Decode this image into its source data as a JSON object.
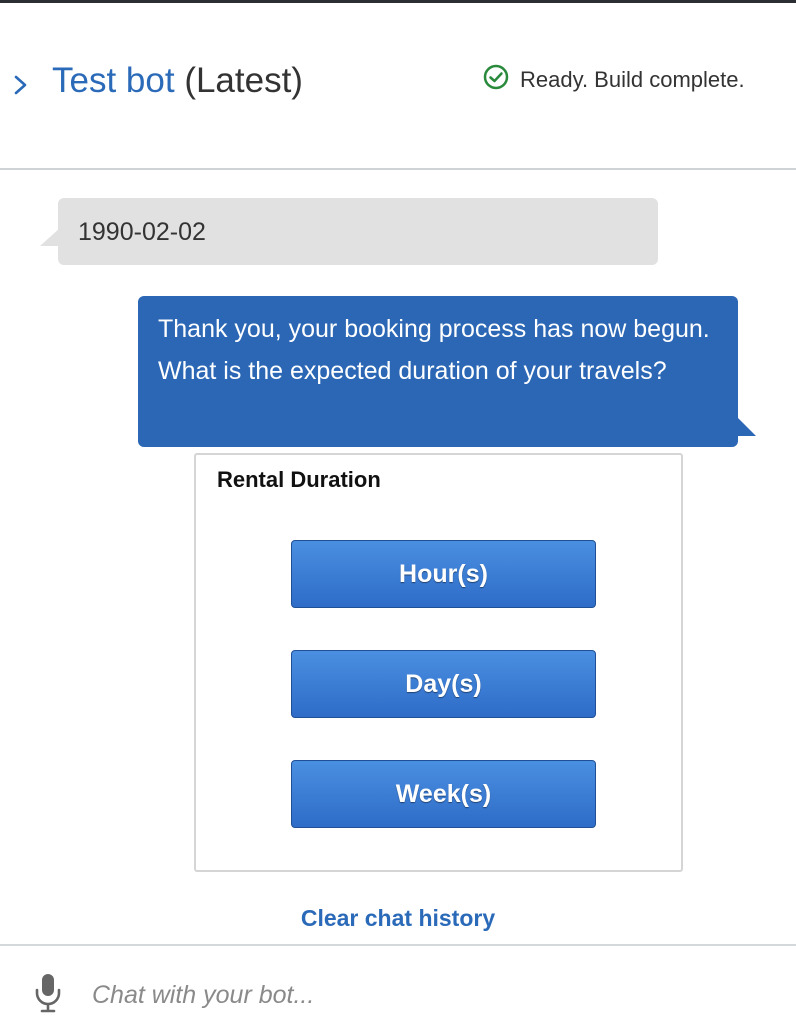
{
  "header": {
    "bot_name": "Test bot",
    "version": "(Latest)",
    "status": "Ready. Build complete.",
    "status_icon": "check-circle-icon",
    "status_color": "#2a8a3c"
  },
  "messages": {
    "user": "1990-02-02",
    "bot": "Thank you, your booking process has now begun. What is the expected duration of your travels?"
  },
  "card": {
    "title": "Rental Duration",
    "buttons": [
      "Hour(s)",
      "Day(s)",
      "Week(s)"
    ]
  },
  "clear_history": "Clear chat history",
  "chat_input": {
    "placeholder": "Chat with your bot...",
    "value": ""
  },
  "colors": {
    "accent": "#2a6ab8",
    "bot_bubble": "#2b67b4",
    "user_bubble": "#e1e1e1"
  }
}
